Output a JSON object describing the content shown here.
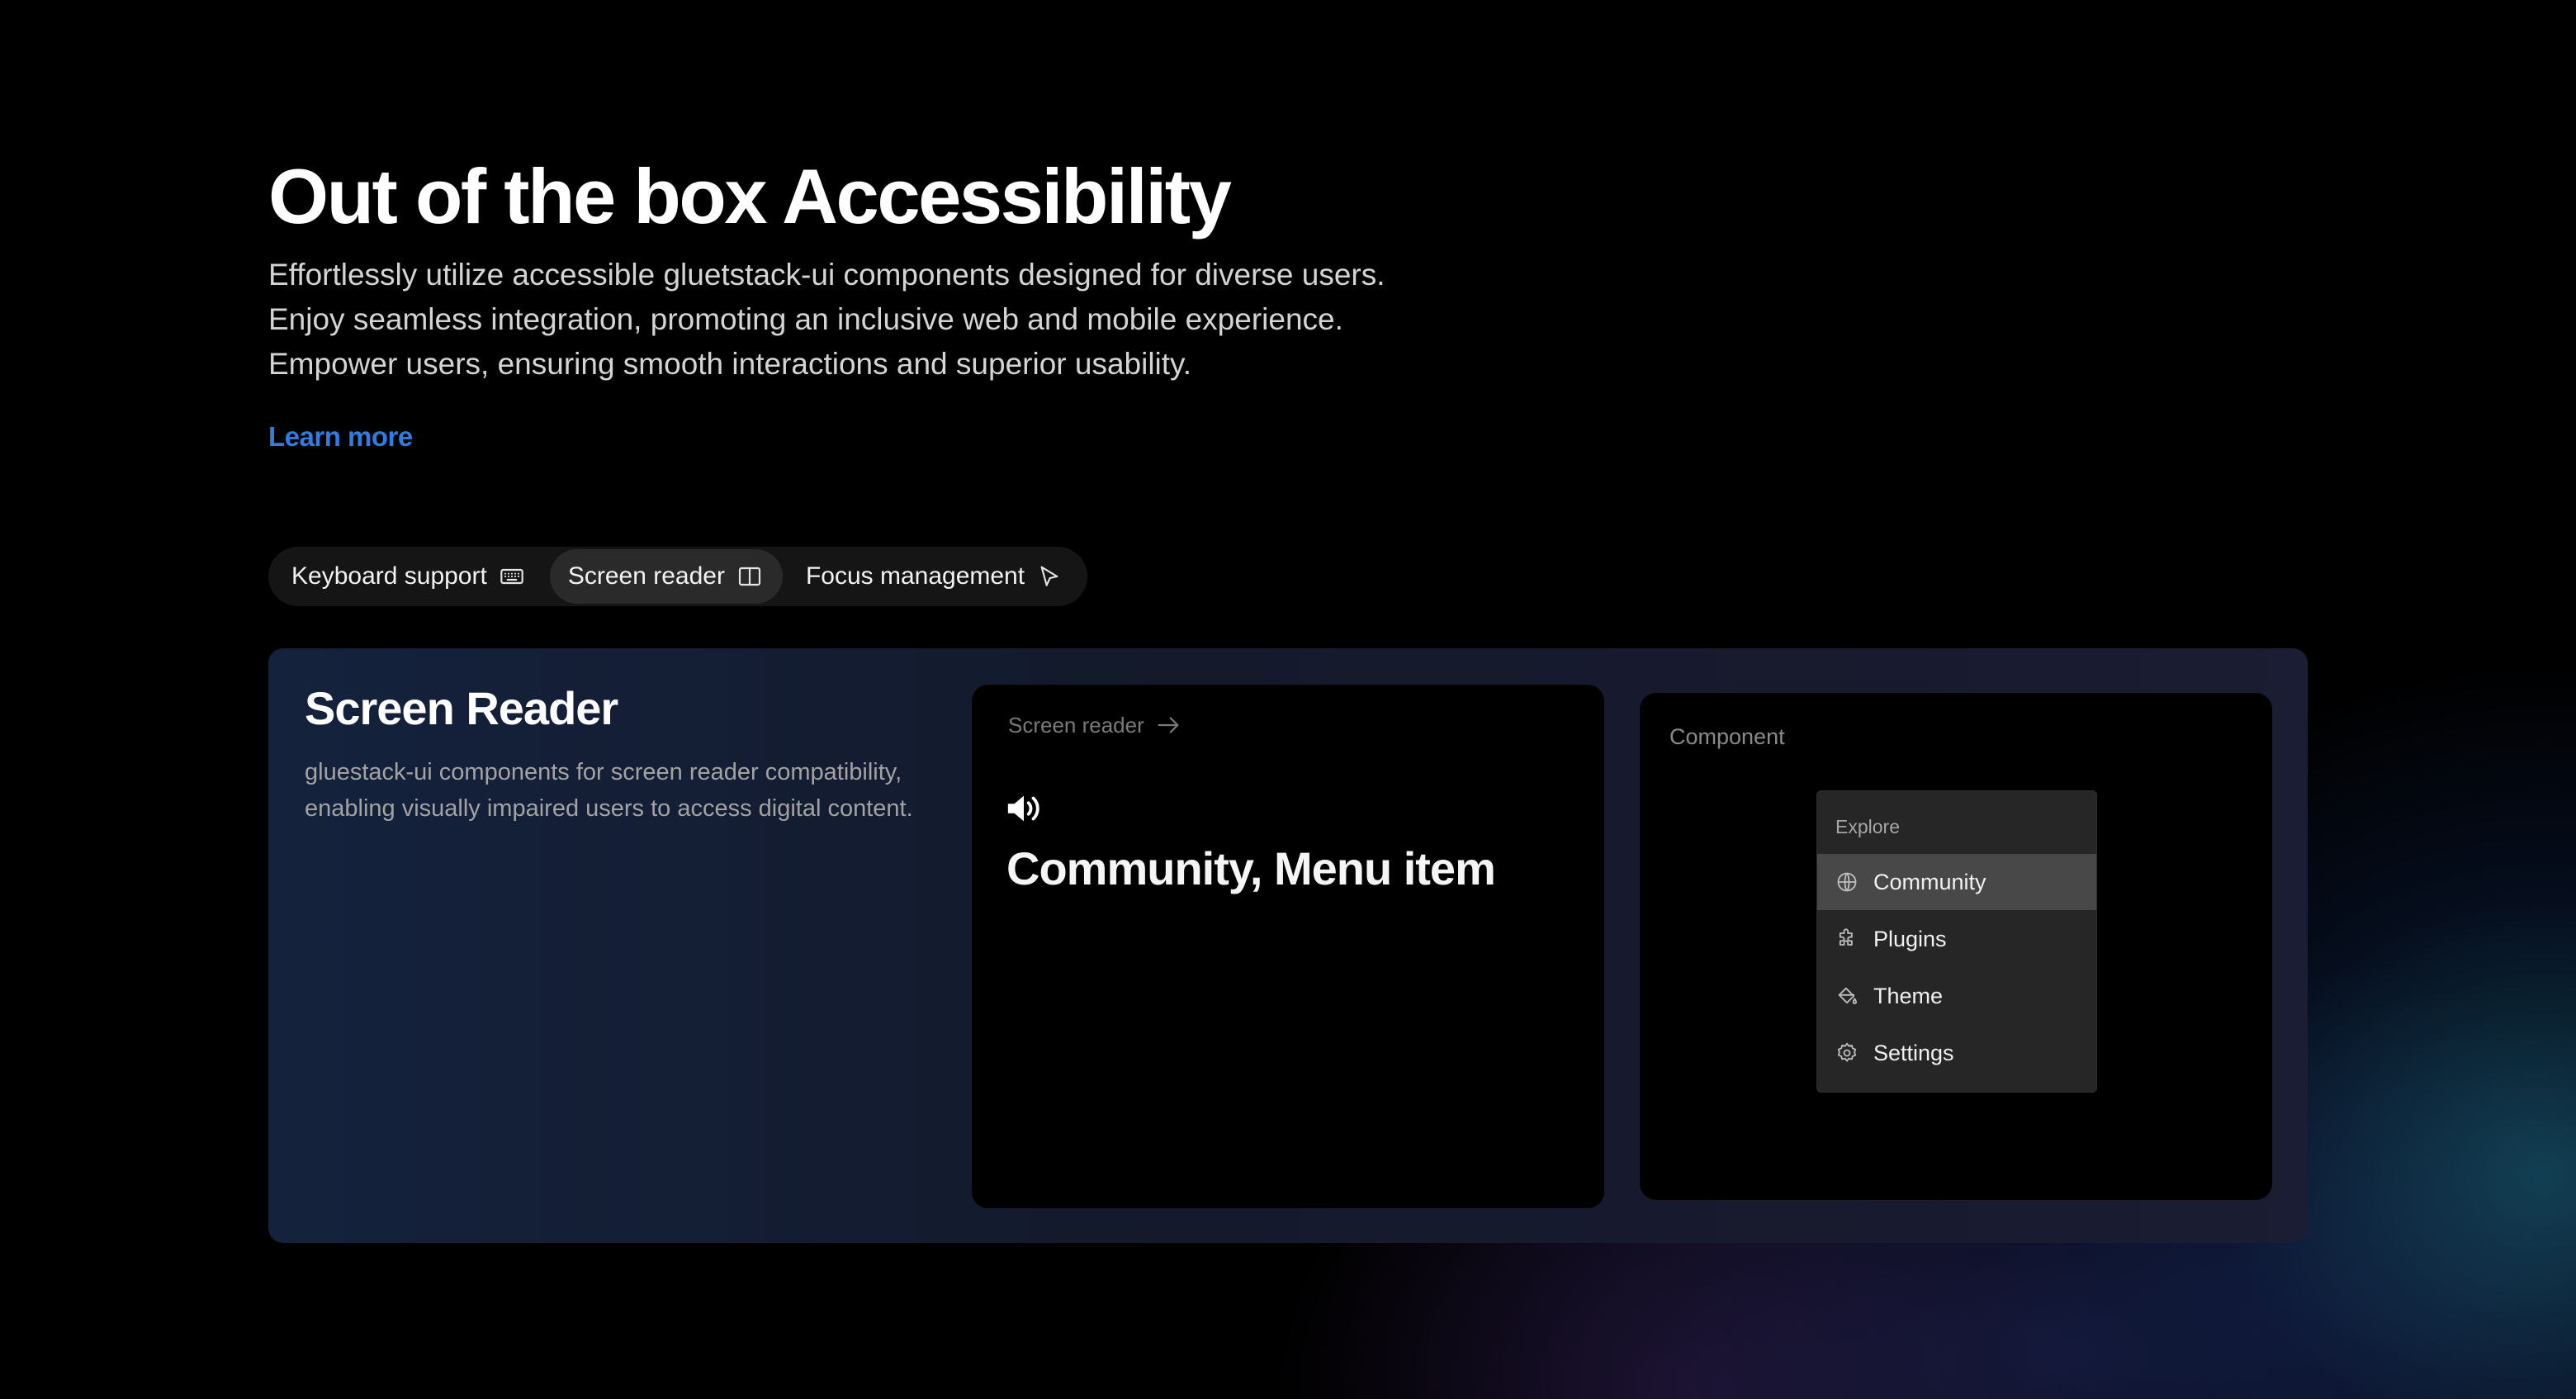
{
  "hero": {
    "title": "Out of the box Accessibility",
    "description": "Effortlessly utilize accessible gluetstack-ui components designed for diverse users. Enjoy seamless integration, promoting an inclusive web and mobile experience. Empower users, ensuring smooth interactions and superior usability.",
    "learn_more": "Learn more",
    "learn_more_color": "#2f7de1"
  },
  "tabs": [
    {
      "label": "Keyboard support",
      "icon": "keyboard-icon",
      "active": false
    },
    {
      "label": "Screen reader",
      "icon": "book-open-icon",
      "active": true
    },
    {
      "label": "Focus management",
      "icon": "cursor-icon",
      "active": false
    }
  ],
  "panel": {
    "title": "Screen Reader",
    "description": "gluestack-ui components for screen reader compatibility, enabling visually impaired users to access digital content.",
    "screen_reader_card": {
      "header": "Screen reader",
      "header_icon": "arrow-right-icon",
      "speaker_icon": "speaker-icon",
      "announcement": "Community, Menu item"
    },
    "component_card": {
      "label": "Component",
      "menu": {
        "heading": "Explore",
        "items": [
          {
            "label": "Community",
            "icon": "globe-icon",
            "highlighted": true
          },
          {
            "label": "Plugins",
            "icon": "puzzle-icon",
            "highlighted": false
          },
          {
            "label": "Theme",
            "icon": "paint-bucket-icon",
            "highlighted": false
          },
          {
            "label": "Settings",
            "icon": "gear-icon",
            "highlighted": false
          }
        ]
      }
    }
  }
}
